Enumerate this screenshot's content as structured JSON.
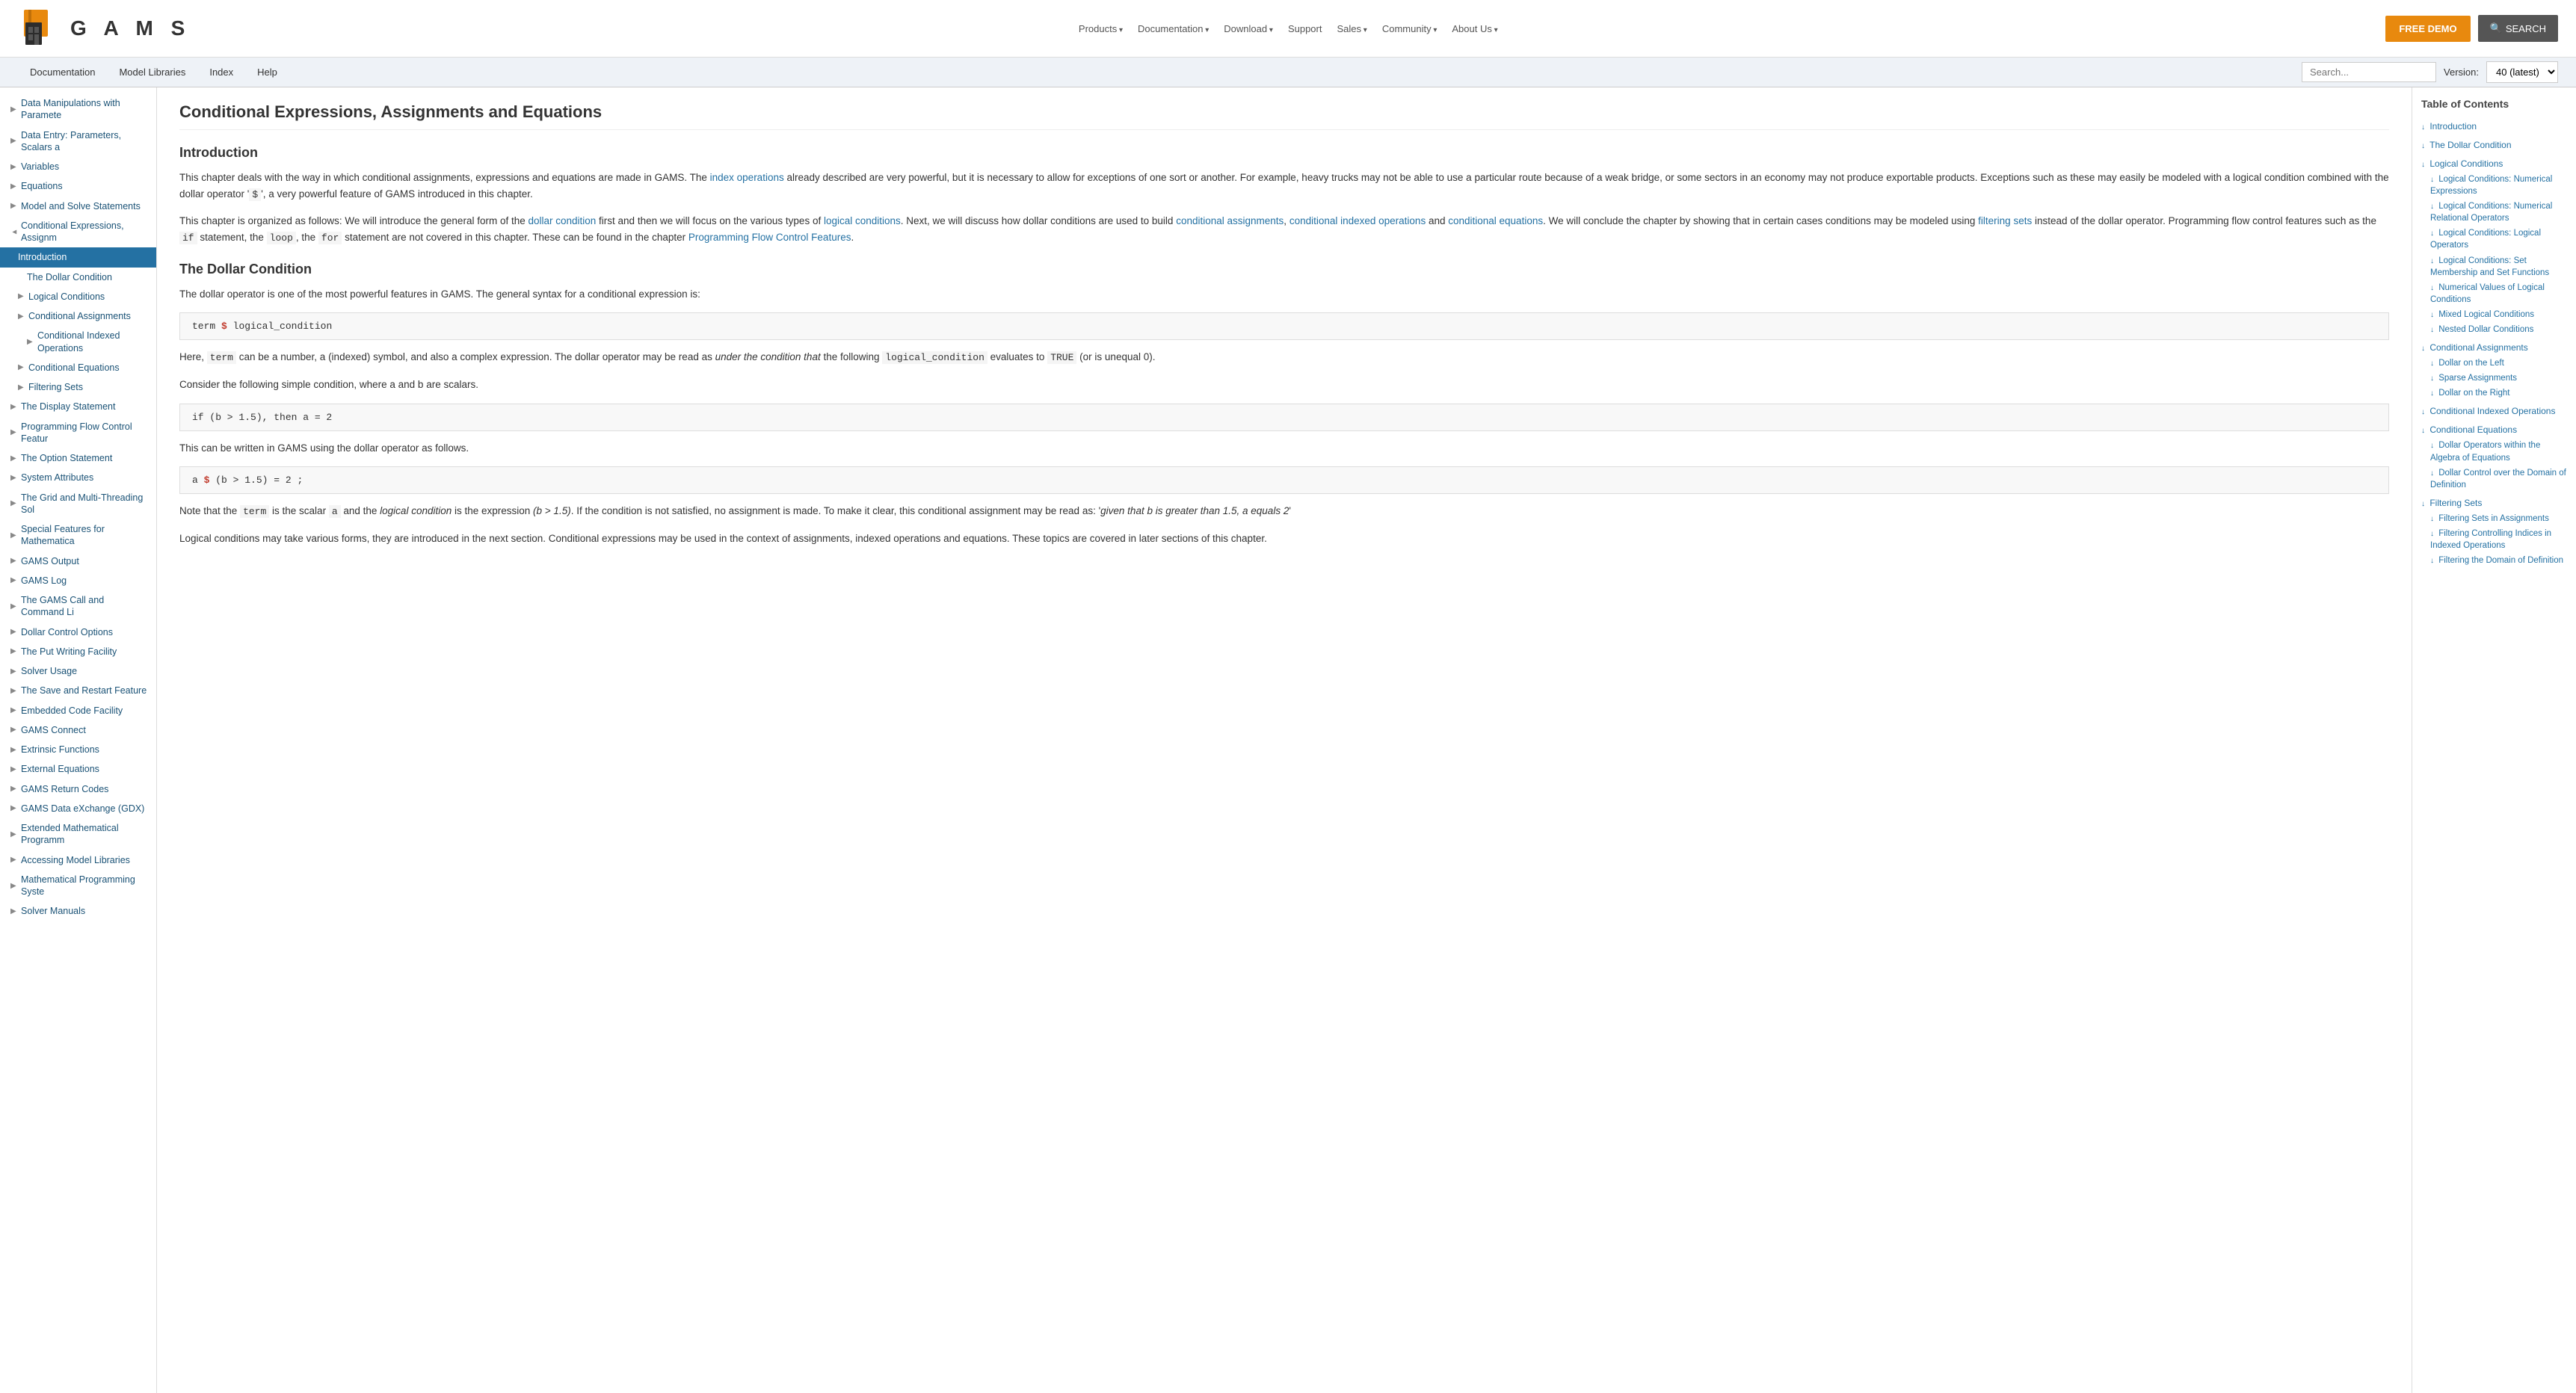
{
  "header": {
    "logo_text": "G A M S",
    "nav_items": [
      {
        "label": "Products",
        "has_arrow": true
      },
      {
        "label": "Documentation",
        "has_arrow": true
      },
      {
        "label": "Download",
        "has_arrow": true
      },
      {
        "label": "Support",
        "has_arrow": false
      },
      {
        "label": "Sales",
        "has_arrow": true
      },
      {
        "label": "Community",
        "has_arrow": true
      },
      {
        "label": "About Us",
        "has_arrow": true
      }
    ],
    "btn_demo": "FREE DEMO",
    "btn_search": "SEARCH"
  },
  "sec_nav": {
    "links": [
      "Documentation",
      "Model Libraries",
      "Index",
      "Help"
    ],
    "search_placeholder": "Search...",
    "version_label": "Version:",
    "version_value": "40 (latest)"
  },
  "sidebar": {
    "items": [
      {
        "label": "Data Manipulations with Paramete",
        "level": 0,
        "has_arrow": true,
        "active": false
      },
      {
        "label": "Data Entry: Parameters, Scalars a",
        "level": 0,
        "has_arrow": true,
        "active": false
      },
      {
        "label": "Variables",
        "level": 0,
        "has_arrow": true,
        "active": false
      },
      {
        "label": "Equations",
        "level": 0,
        "has_arrow": true,
        "active": false
      },
      {
        "label": "Model and Solve Statements",
        "level": 0,
        "has_arrow": true,
        "active": false
      },
      {
        "label": "Conditional Expressions, Assignm",
        "level": 0,
        "has_arrow": true,
        "open": true,
        "active": false
      },
      {
        "label": "Introduction",
        "level": 1,
        "has_arrow": false,
        "active": true
      },
      {
        "label": "The Dollar Condition",
        "level": 2,
        "has_arrow": false,
        "active": false
      },
      {
        "label": "Logical Conditions",
        "level": 1,
        "has_arrow": true,
        "active": false
      },
      {
        "label": "Conditional Assignments",
        "level": 1,
        "has_arrow": true,
        "active": false
      },
      {
        "label": "Conditional Indexed Operations",
        "level": 2,
        "has_arrow": true,
        "active": false
      },
      {
        "label": "Conditional Equations",
        "level": 1,
        "has_arrow": true,
        "active": false
      },
      {
        "label": "Filtering Sets",
        "level": 1,
        "has_arrow": true,
        "active": false
      },
      {
        "label": "The Display Statement",
        "level": 0,
        "has_arrow": true,
        "active": false
      },
      {
        "label": "Programming Flow Control Featur",
        "level": 0,
        "has_arrow": true,
        "active": false
      },
      {
        "label": "The Option Statement",
        "level": 0,
        "has_arrow": true,
        "active": false
      },
      {
        "label": "System Attributes",
        "level": 0,
        "has_arrow": true,
        "active": false
      },
      {
        "label": "The Grid and Multi-Threading Sol",
        "level": 0,
        "has_arrow": true,
        "active": false
      },
      {
        "label": "Special Features for Mathematica",
        "level": 0,
        "has_arrow": true,
        "active": false
      },
      {
        "label": "GAMS Output",
        "level": 0,
        "has_arrow": true,
        "active": false
      },
      {
        "label": "GAMS Log",
        "level": 0,
        "has_arrow": true,
        "active": false
      },
      {
        "label": "The GAMS Call and Command Li",
        "level": 0,
        "has_arrow": true,
        "active": false
      },
      {
        "label": "Dollar Control Options",
        "level": 0,
        "has_arrow": true,
        "active": false
      },
      {
        "label": "The Put Writing Facility",
        "level": 0,
        "has_arrow": true,
        "active": false
      },
      {
        "label": "Solver Usage",
        "level": 0,
        "has_arrow": true,
        "active": false
      },
      {
        "label": "The Save and Restart Feature",
        "level": 0,
        "has_arrow": true,
        "active": false
      },
      {
        "label": "Embedded Code Facility",
        "level": 0,
        "has_arrow": true,
        "active": false
      },
      {
        "label": "GAMS Connect",
        "level": 0,
        "has_arrow": true,
        "active": false
      },
      {
        "label": "Extrinsic Functions",
        "level": 0,
        "has_arrow": true,
        "active": false
      },
      {
        "label": "External Equations",
        "level": 0,
        "has_arrow": true,
        "active": false
      },
      {
        "label": "GAMS Return Codes",
        "level": 0,
        "has_arrow": true,
        "active": false
      },
      {
        "label": "GAMS Data eXchange (GDX)",
        "level": 0,
        "has_arrow": true,
        "active": false
      },
      {
        "label": "Extended Mathematical Programm",
        "level": 0,
        "has_arrow": true,
        "active": false
      },
      {
        "label": "Accessing Model Libraries",
        "level": 0,
        "has_arrow": true,
        "active": false
      },
      {
        "label": "Mathematical Programming Syste",
        "level": 0,
        "has_arrow": true,
        "active": false
      },
      {
        "label": "Solver Manuals",
        "level": 0,
        "has_arrow": true,
        "active": false
      }
    ]
  },
  "content": {
    "page_title": "Conditional Expressions, Assignments and Equations",
    "intro_title": "Introduction",
    "intro_p1": "This chapter deals with the way in which conditional assignments, expressions and equations are made in GAMS. The index operations already described are very powerful, but it is necessary to allow for exceptions of one sort or another. For example, heavy trucks may not be able to use a particular route because of a weak bridge, or some sectors in an economy may not produce exportable products. Exceptions such as these may easily be modeled with a logical condition combined with the dollar operator '$', a very powerful feature of GAMS introduced in this chapter.",
    "intro_p1_link1": "index operations",
    "intro_p2_prefix": "This chapter is organized as follows: We will introduce the general form of the",
    "intro_p2_link1": "dollar condition",
    "intro_p2_mid1": "first and then we will focus on the various types of",
    "intro_p2_link2": "logical conditions",
    "intro_p2_mid2": ". Next, we will discuss how dollar conditions are used to build",
    "intro_p2_link3": "conditional assignments",
    "intro_p2_comma": ",",
    "intro_p2_link4": "conditional indexed operations",
    "intro_p2_and": "and",
    "intro_p2_link5": "conditional equations",
    "intro_p2_mid3": ". We will conclude the chapter by showing that in certain cases conditions may be modeled using",
    "intro_p2_link6": "filtering sets",
    "intro_p2_mid4": "instead of the dollar operator. Programming flow control features such as the",
    "intro_p2_if": "if",
    "intro_p2_mid5": "statement, the",
    "intro_p2_loop": "loop",
    "intro_p2_mid6": ", the",
    "intro_p2_for": "for",
    "intro_p2_mid7": "statement are not covered in this chapter. These can be found in the chapter",
    "intro_p2_link7": "Programming Flow Control Features",
    "dollar_title": "The Dollar Condition",
    "dollar_p1": "The dollar operator is one of the most powerful features in GAMS. The general syntax for a conditional expression is:",
    "code1": "term $ logical_condition",
    "dollar_p2_1": "Here,",
    "dollar_p2_term": "term",
    "dollar_p2_2": "can be a number, a (indexed) symbol, and also a complex expression. The dollar operator may be read as",
    "dollar_p2_italic": "under the condition that",
    "dollar_p2_3": "the following",
    "dollar_p2_code": "logical_condition",
    "dollar_p2_4": "evaluates to",
    "dollar_p2_true": "TRUE",
    "dollar_p2_5": "(or is unequal 0).",
    "dollar_p3": "Consider the following simple condition, where a and b are scalars.",
    "code2": "if (b > 1.5), then a = 2",
    "dollar_p4": "This can be written in GAMS using the dollar operator as follows.",
    "code3_1": "a",
    "code3_dollar": "$",
    "code3_2": "(b > 1.5)",
    "code3_3": "= 2",
    "code3_semi": ";",
    "dollar_p5_1": "Note that the",
    "dollar_p5_term": "term",
    "dollar_p5_2": "is the scalar",
    "dollar_p5_a": "a",
    "dollar_p5_3": "and the",
    "dollar_p5_lc": "logical condition",
    "dollar_p5_4": "is the expression",
    "dollar_p5_expr": "(b > 1.5)",
    "dollar_p5_5": ". If the condition is not satisfied, no assignment is made. To make it clear, this conditional assignment may be read as:",
    "dollar_p5_quote": "'given that b is greater than 1.5, a equals 2'",
    "dollar_p6": "Logical conditions may take various forms, they are introduced in the next section. Conditional expressions may be used in the context of assignments, indexed operations and equations. These topics are covered in later sections of this chapter."
  },
  "toc": {
    "title": "Table of Contents",
    "items": [
      {
        "label": "Introduction",
        "level": 0
      },
      {
        "label": "The Dollar Condition",
        "level": 0
      },
      {
        "label": "Logical Conditions",
        "level": 0
      },
      {
        "label": "Logical Conditions: Numerical Expressions",
        "level": 1
      },
      {
        "label": "Logical Conditions: Numerical Relational Operators",
        "level": 1
      },
      {
        "label": "Logical Conditions: Logical Operators",
        "level": 1
      },
      {
        "label": "Logical Conditions: Set Membership and Set Functions",
        "level": 1
      },
      {
        "label": "Numerical Values of Logical Conditions",
        "level": 1
      },
      {
        "label": "Mixed Logical Conditions",
        "level": 1
      },
      {
        "label": "Nested Dollar Conditions",
        "level": 1
      },
      {
        "label": "Conditional Assignments",
        "level": 0
      },
      {
        "label": "Dollar on the Left",
        "level": 1
      },
      {
        "label": "Sparse Assignments",
        "level": 1
      },
      {
        "label": "Dollar on the Right",
        "level": 1
      },
      {
        "label": "Conditional Indexed Operations",
        "level": 0
      },
      {
        "label": "Conditional Equations",
        "level": 0
      },
      {
        "label": "Dollar Operators within the Algebra of Equations",
        "level": 1
      },
      {
        "label": "Dollar Control over the Domain of Definition",
        "level": 1
      },
      {
        "label": "Filtering Sets",
        "level": 0
      },
      {
        "label": "Filtering Sets in Assignments",
        "level": 1
      },
      {
        "label": "Filtering Controlling Indices in Indexed Operations",
        "level": 1
      },
      {
        "label": "Filtering the Domain of Definition",
        "level": 1
      }
    ]
  }
}
